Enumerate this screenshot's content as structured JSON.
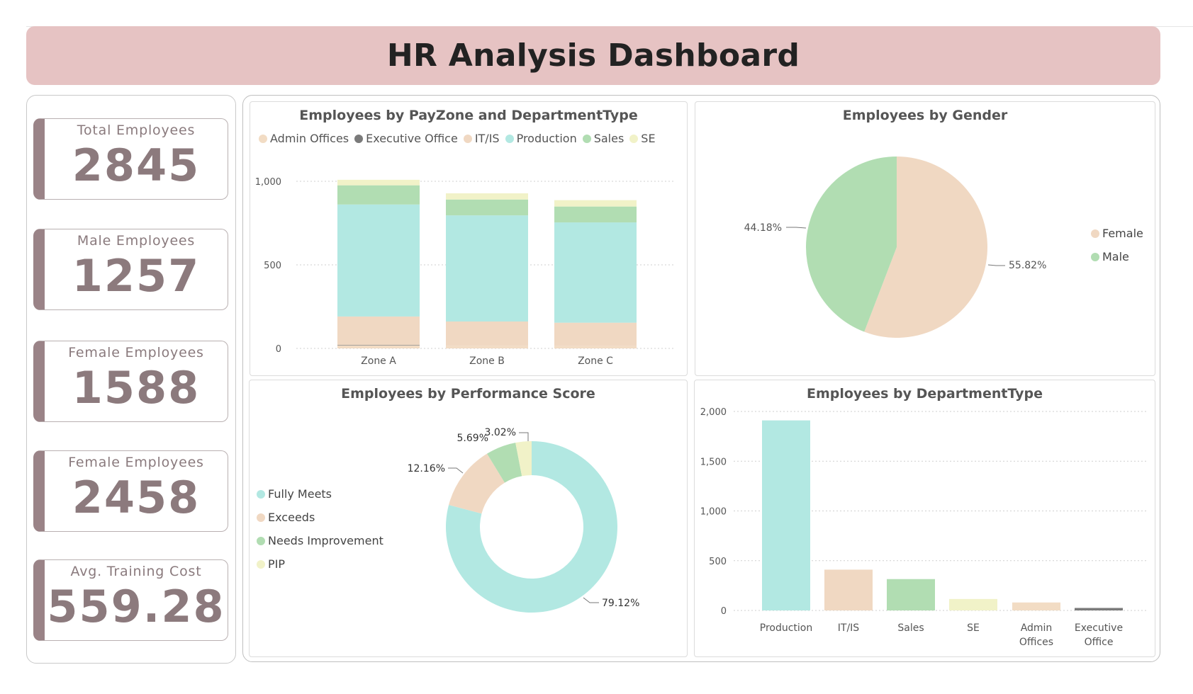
{
  "header": {
    "title": "HR Analysis Dashboard"
  },
  "kpis": [
    {
      "label": "Total Employees",
      "value": "2845"
    },
    {
      "label": "Male Employees",
      "value": "1257"
    },
    {
      "label": "Female Employees",
      "value": "1588"
    },
    {
      "label": "Female Employees",
      "value": "2458"
    },
    {
      "label": "Avg. Training Cost",
      "value": "559.28"
    }
  ],
  "colors": {
    "admin_offices": "#f2dcc4",
    "executive_office": "#7a7a7a",
    "it_is": "#f0d8c2",
    "production": "#b2e8e2",
    "sales": "#b1ddb2",
    "se": "#f1f2c8",
    "female": "#f0d8c2",
    "male": "#b1ddb2",
    "fully_meets": "#b2e8e2",
    "exceeds": "#f0d8c2",
    "needs_improvement": "#b1ddb2",
    "pip": "#f1f2c8"
  },
  "chart_data": [
    {
      "id": "payzone",
      "type": "bar",
      "stacked": true,
      "title": "Employees by PayZone and DepartmentType",
      "categories": [
        "Zone A",
        "Zone B",
        "Zone C"
      ],
      "series": [
        {
          "name": "Admin Offices",
          "color_key": "admin_offices",
          "values": [
            18,
            16,
            14
          ]
        },
        {
          "name": "Executive Office",
          "color_key": "executive_office",
          "values": [
            3,
            0,
            0
          ]
        },
        {
          "name": "IT/IS",
          "color_key": "it_is",
          "values": [
            170,
            145,
            140
          ]
        },
        {
          "name": "Production",
          "color_key": "production",
          "values": [
            670,
            635,
            600
          ]
        },
        {
          "name": "Sales",
          "color_key": "sales",
          "values": [
            115,
            95,
            95
          ]
        },
        {
          "name": "SE",
          "color_key": "se",
          "values": [
            33,
            37,
            38
          ]
        }
      ],
      "yticks": [
        0,
        500,
        1000
      ],
      "yticklabels": [
        "0",
        "500",
        "1,000"
      ],
      "ylim": [
        0,
        1100
      ],
      "legend": "top",
      "grid": true
    },
    {
      "id": "gender",
      "type": "pie",
      "title": "Employees by Gender",
      "slices": [
        {
          "name": "Female",
          "color_key": "female",
          "value": 55.82,
          "label": "55.82%"
        },
        {
          "name": "Male",
          "color_key": "male",
          "value": 44.18,
          "label": "44.18%"
        }
      ],
      "legend": "right"
    },
    {
      "id": "performance",
      "type": "pie",
      "donut": true,
      "title": "Employees by Performance Score",
      "slices": [
        {
          "name": "Fully Meets",
          "color_key": "fully_meets",
          "value": 79.12,
          "label": "79.12%"
        },
        {
          "name": "Exceeds",
          "color_key": "exceeds",
          "value": 12.16,
          "label": "12.16%"
        },
        {
          "name": "Needs Improvement",
          "color_key": "needs_improvement",
          "value": 5.69,
          "label": "5.69%"
        },
        {
          "name": "PIP",
          "color_key": "pip",
          "value": 3.02,
          "label": "3.02%"
        }
      ],
      "legend": "left"
    },
    {
      "id": "department",
      "type": "bar",
      "title": "Employees by DepartmentType",
      "categories": [
        "Production",
        "IT/IS",
        "Sales",
        "SE",
        "Admin Offices",
        "Executive Office"
      ],
      "category_lines": [
        [
          "Production"
        ],
        [
          "IT/IS"
        ],
        [
          "Sales"
        ],
        [
          "SE"
        ],
        [
          "Admin",
          "Offices"
        ],
        [
          "Executive",
          "Office"
        ]
      ],
      "values": [
        1910,
        410,
        315,
        115,
        80,
        25
      ],
      "color_keys": [
        "production",
        "it_is",
        "sales",
        "se",
        "admin_offices",
        "executive_office"
      ],
      "yticks": [
        0,
        500,
        1000,
        1500,
        2000
      ],
      "yticklabels": [
        "0",
        "500",
        "1,000",
        "1,500",
        "2,000"
      ],
      "ylim": [
        0,
        2000
      ],
      "grid": true
    }
  ]
}
